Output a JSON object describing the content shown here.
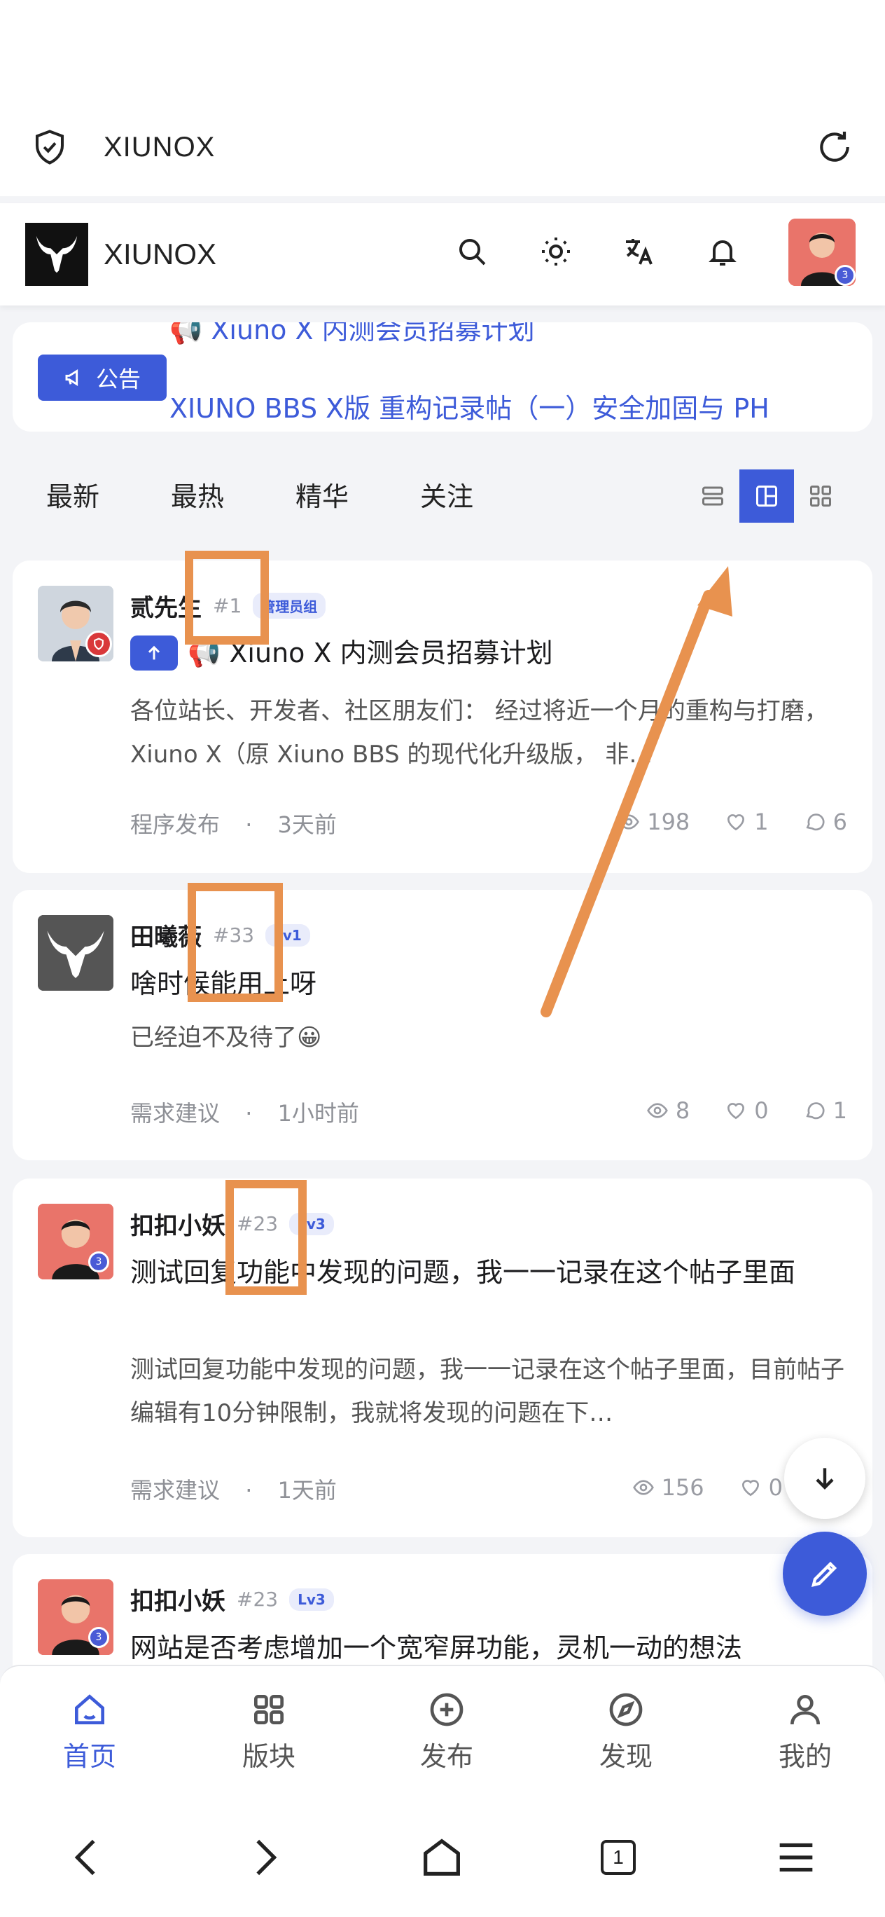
{
  "browser": {
    "url": "XIUNOX"
  },
  "header": {
    "site_name": "XIUNOX"
  },
  "notice": {
    "tag": "公告",
    "lines": [
      "📢 Xiuno X 内测会员招募计划",
      "XIUNO BBS X版 重构记录帖（一）安全加固与 PH"
    ]
  },
  "tabs": [
    "最新",
    "最热",
    "精华",
    "关注"
  ],
  "posts": [
    {
      "author": "贰先生",
      "pid": "#1",
      "badge": "管理员组",
      "title": "📢 Xiuno X 内测会员招募计划",
      "excerpt": "各位站长、开发者、社区朋友们： 经过将近一个月的重构与打磨，Xiuno X（原 Xiuno BBS 的现代化升级版， 非…",
      "category": "程序发布",
      "time": "3天前",
      "views": "198",
      "likes": "1",
      "comments": "6"
    },
    {
      "author": "田曦薇",
      "pid": "#33",
      "badge": "Lv1",
      "title": "啥时候能用上呀",
      "excerpt": "已经迫不及待了😀",
      "category": "需求建议",
      "time": "1小时前",
      "views": "8",
      "likes": "0",
      "comments": "1"
    },
    {
      "author": "扣扣小妖",
      "pid": "#23",
      "badge": "Lv3",
      "title": "测试回复功能中发现的问题，我一一记录在这个帖子里面",
      "excerpt": "测试回复功能中发现的问题，我一一记录在这个帖子里面，目前帖子编辑有10分钟限制，我就将发现的问题在下…",
      "category": "需求建议",
      "time": "1天前",
      "views": "156",
      "likes": "0",
      "comments": ""
    },
    {
      "author": "扣扣小妖",
      "pid": "#23",
      "badge": "Lv3",
      "title": "网站是否考虑增加一个宽窄屏功能，灵机一动的想法"
    }
  ],
  "avatar_badge": "3",
  "bottom_nav": [
    "首页",
    "版块",
    "发布",
    "发现",
    "我的"
  ],
  "sys_tab_count": "1",
  "colors": {
    "accent": "#3d5bd9",
    "annotation": "#e8924f"
  }
}
